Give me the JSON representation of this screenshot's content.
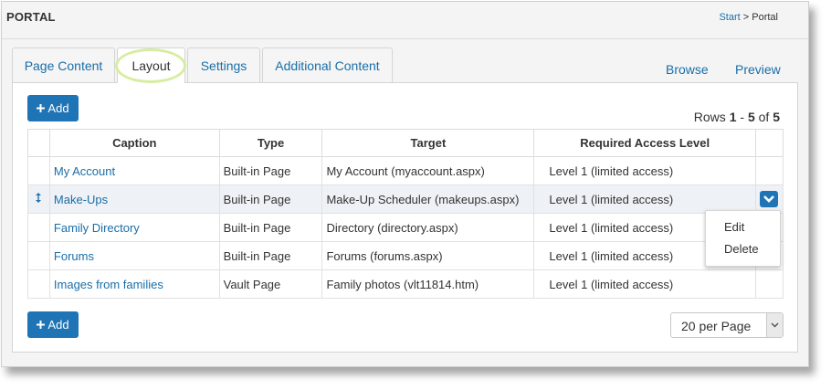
{
  "header": {
    "title": "PORTAL",
    "breadcrumb": {
      "start": "Start",
      "separator": ">",
      "current": "Portal"
    }
  },
  "tabs": [
    {
      "label": "Page Content"
    },
    {
      "label": "Layout",
      "active": true
    },
    {
      "label": "Settings"
    },
    {
      "label": "Additional Content"
    }
  ],
  "actions": {
    "browse": "Browse",
    "preview": "Preview"
  },
  "toolbar": {
    "add_label": "Add",
    "add_icon": "plus-icon"
  },
  "rows_info": {
    "prefix": "Rows",
    "from": "1",
    "dash": "-",
    "to": "5",
    "of": "of",
    "total": "5"
  },
  "table": {
    "columns": [
      "Caption",
      "Type",
      "Target",
      "Required Access Level"
    ],
    "rows": [
      {
        "caption": "My Account",
        "type": "Built-in Page",
        "target": "My Account (myaccount.aspx)",
        "access": "Level 1 (limited access)"
      },
      {
        "caption": "Make-Ups",
        "type": "Built-in Page",
        "target": "Make-Up Scheduler (makeups.aspx)",
        "access": "Level 1 (limited access)"
      },
      {
        "caption": "Family Directory",
        "type": "Built-in Page",
        "target": "Directory (directory.aspx)",
        "access": "Level 1 (limited access)"
      },
      {
        "caption": "Forums",
        "type": "Built-in Page",
        "target": "Forums (forums.aspx)",
        "access": "Level 1 (limited access)"
      },
      {
        "caption": "Images from families",
        "type": "Vault Page",
        "target": "Family photos (vlt11814.htm)",
        "access": "Level 1 (limited access)"
      }
    ]
  },
  "row_menu": {
    "edit": "Edit",
    "delete": "Delete"
  },
  "pagination": {
    "per_page": "20 per Page"
  },
  "colors": {
    "accent": "#1f74b5",
    "link": "#1a6ea8",
    "highlight_ring": "#d6eda1"
  }
}
